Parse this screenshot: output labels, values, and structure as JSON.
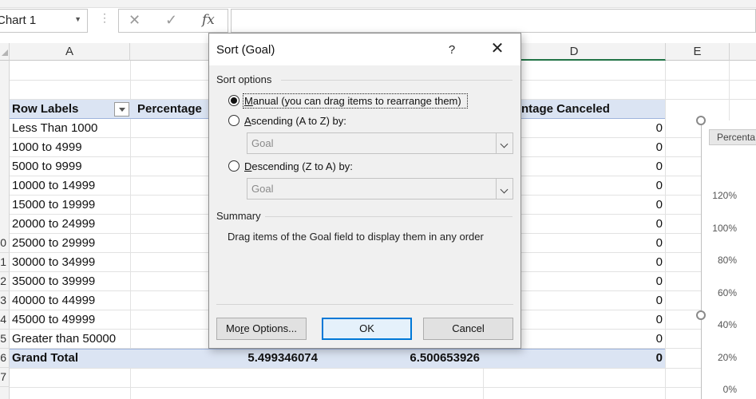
{
  "name_box": {
    "value": "Chart 1"
  },
  "formula_bar": {
    "cancel_icon": "✕",
    "enter_icon": "✓",
    "fx_label": "fx",
    "value": ""
  },
  "columns": [
    "A",
    "",
    "",
    "D",
    "E"
  ],
  "rows": [
    "",
    "",
    "",
    "",
    "",
    "",
    "",
    "",
    "",
    "",
    "",
    "",
    "0",
    "1",
    "2",
    "3",
    "4",
    "5",
    "6",
    "7"
  ],
  "pivot": {
    "header": {
      "row_labels": "Row Labels",
      "col_b": "Percentage",
      "col_d": "ntage Canceled"
    },
    "items": [
      {
        "label": "Less Than 1000",
        "value": "0"
      },
      {
        "label": "1000 to 4999",
        "value": "0"
      },
      {
        "label": "5000 to 9999",
        "value": "0"
      },
      {
        "label": "10000 to 14999",
        "value": "0"
      },
      {
        "label": "15000 to 19999",
        "value": "0"
      },
      {
        "label": "20000 to 24999",
        "value": "0"
      },
      {
        "label": "25000 to 29999",
        "value": "0"
      },
      {
        "label": "30000 to 34999",
        "value": "0"
      },
      {
        "label": "35000 to 39999",
        "value": "0"
      },
      {
        "label": "40000 to 44999",
        "value": "0"
      },
      {
        "label": "45000 to 49999",
        "value": "0"
      },
      {
        "label": "Greater than 50000",
        "value": "0"
      }
    ],
    "grand_total": {
      "label": "Grand Total",
      "col_b": "5.499346074",
      "col_c": "6.500653926",
      "col_d": "0"
    }
  },
  "chart": {
    "title_fragment": "Percenta",
    "y_ticks": [
      "120%",
      "100%",
      "80%",
      "60%",
      "40%",
      "20%",
      "0%"
    ]
  },
  "dialog": {
    "title": "Sort (Goal)",
    "help": "?",
    "close_icon": "✕",
    "sort_options_label": "Sort options",
    "manual": {
      "hotkey": "M",
      "rest": "anual (you can drag items to rearrange them)",
      "selected": true
    },
    "ascending": {
      "hotkey": "A",
      "rest": "scending (A to Z) by:",
      "selected": false,
      "value": "Goal"
    },
    "descending": {
      "hotkey": "D",
      "rest": "escending (Z to A) by:",
      "selected": false,
      "value": "Goal"
    },
    "summary_label": "Summary",
    "summary_text": "Drag items of the Goal field to display them in any order",
    "more_options_pre": "Mo",
    "more_options_hotkey": "r",
    "more_options_post": "e Options...",
    "ok": "OK",
    "cancel": "Cancel"
  }
}
